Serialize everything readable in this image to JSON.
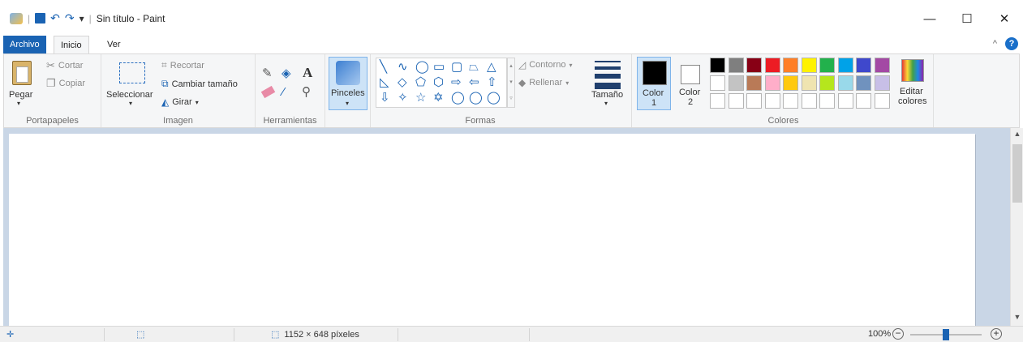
{
  "titlebar": {
    "title": "Sin título - Paint",
    "separator": "|",
    "dropdown": "▾",
    "minimize": "—",
    "maximize": "☐",
    "close": "✕"
  },
  "tabs": {
    "file": "Archivo",
    "home": "Inicio",
    "view": "Ver",
    "collapse": "^",
    "help": "?"
  },
  "clipboard": {
    "paste": "Pegar",
    "cut": "Cortar",
    "copy": "Copiar",
    "group": "Portapapeles"
  },
  "image": {
    "select": "Seleccionar",
    "crop": "Recortar",
    "resize": "Cambiar tamaño",
    "rotate": "Girar",
    "group": "Imagen"
  },
  "tools": {
    "group": "Herramientas",
    "text": "A"
  },
  "brushes": {
    "label": "Pinceles"
  },
  "shapes": {
    "outline": "Contorno",
    "fill": "Rellenar",
    "group": "Formas",
    "glyphs": [
      "╲",
      "∿",
      "◯",
      "▭",
      "▢",
      "⏢",
      "△",
      "◺",
      "◇",
      "⬠",
      "⬡",
      "⇨",
      "⇦",
      "⇧",
      "⇩",
      "✧",
      "☆",
      "✡",
      "◯",
      "◯",
      "◯"
    ]
  },
  "size": {
    "label": "Tamaño"
  },
  "colors": {
    "color1_label": "Color",
    "color1_num": "1",
    "color2_label": "Color",
    "color2_num": "2",
    "edit_l1": "Editar",
    "edit_l2": "colores",
    "group": "Colores",
    "color1": "#000000",
    "color2": "#ffffff",
    "palette_row1": [
      "#000000",
      "#7f7f7f",
      "#880015",
      "#ed1c24",
      "#ff7f27",
      "#fff200",
      "#22b14c",
      "#00a2e8",
      "#3f48cc",
      "#a349a4"
    ],
    "palette_row2": [
      "#ffffff",
      "#c3c3c3",
      "#b97a57",
      "#ffaec9",
      "#ffc90e",
      "#efe4b0",
      "#b5e61d",
      "#99d9ea",
      "#7092be",
      "#c8bfe7"
    ],
    "accent": "#1a63b3"
  },
  "status": {
    "size": "1152 × 648 píxeles",
    "zoom": "100%",
    "zoom_level": 0.5
  }
}
